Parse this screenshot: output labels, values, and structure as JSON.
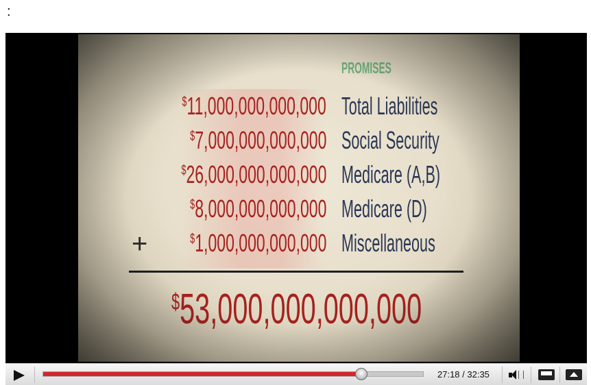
{
  "top_text": ":",
  "slide": {
    "header": "PROMISES",
    "rows": [
      {
        "currency": "$",
        "amount": "11,000,000,000,000",
        "label": "Total Liabilities"
      },
      {
        "currency": "$",
        "amount": "7,000,000,000,000",
        "label": "Social Security"
      },
      {
        "currency": "$",
        "amount": "26,000,000,000,000",
        "label": "Medicare (A,B)"
      },
      {
        "currency": "$",
        "amount": "8,000,000,000,000",
        "label": "Medicare (D)"
      },
      {
        "currency": "$",
        "amount": "1,000,000,000,000",
        "label": "Miscellaneous"
      }
    ],
    "plus_sign": "+",
    "total_currency": "$",
    "total_amount": "53,000,000,000,000"
  },
  "player": {
    "current_time": "27:18",
    "duration": "32:35",
    "time_display": "27:18 / 32:35",
    "progress": 0.838,
    "colors": {
      "progress": "#d3262b",
      "amount": "#a5221f",
      "label": "#2a3655",
      "header": "#6fae7a"
    },
    "icons": [
      "play-icon",
      "volume-icon",
      "popout-icon",
      "expand-icon"
    ]
  }
}
